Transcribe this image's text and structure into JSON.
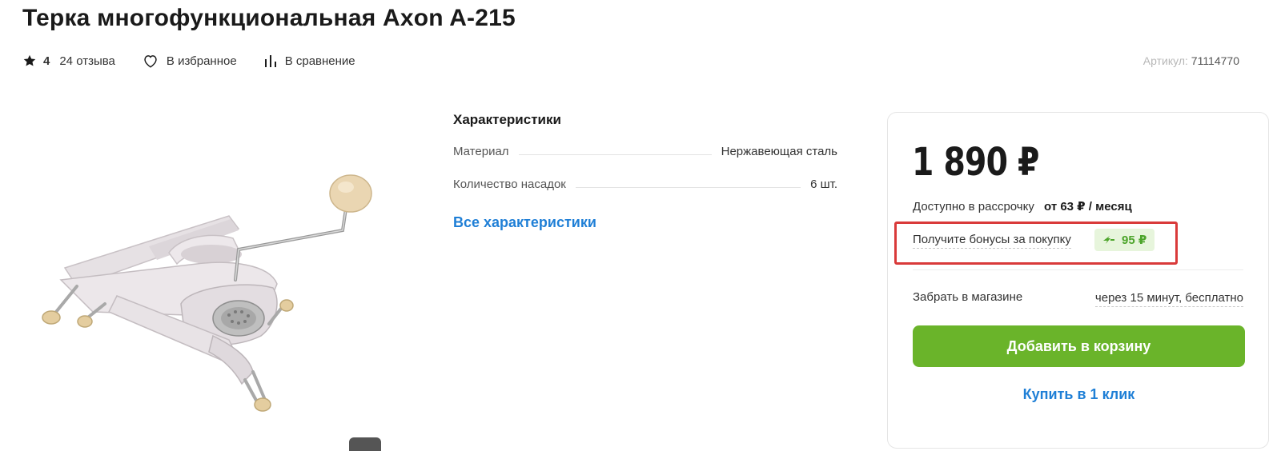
{
  "product": {
    "title": "Терка многофункциональная Axon A-215"
  },
  "meta": {
    "rating": "4",
    "reviews": "24 отзыва",
    "favorite": "В избранное",
    "compare": "В сравнение",
    "sku_label": "Артикул:",
    "sku_value": "71114770"
  },
  "specs": {
    "title": "Характеристики",
    "rows": [
      {
        "name": "Материал",
        "value": "Нержавеющая сталь"
      },
      {
        "name": "Количество насадок",
        "value": "6 шт."
      }
    ],
    "all_link": "Все характеристики"
  },
  "buy": {
    "price": "1 890 ₽",
    "installment_label": "Доступно в рассрочку",
    "installment_value": "от 63 ₽ / месяц",
    "bonus_label": "Получите бонусы за покупку",
    "bonus_value": "95 ₽",
    "pickup_label": "Забрать в магазине",
    "pickup_value": "через 15 минут, бесплатно",
    "add_to_cart": "Добавить в корзину",
    "one_click": "Купить в 1 клик"
  },
  "colors": {
    "accent_green": "#6ab42a",
    "link_blue": "#1f7fd6",
    "highlight_red": "#d93a3a",
    "bonus_green": "#4da52b"
  },
  "icons": {
    "rating": "star-icon",
    "favorite": "heart-icon",
    "compare": "bar-chart-icon",
    "bonus": "bonus-arrow-icon"
  }
}
